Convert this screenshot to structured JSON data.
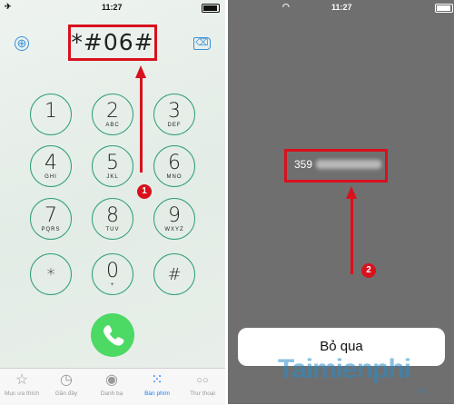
{
  "left_status": {
    "airplane": "✈",
    "time": "11:27"
  },
  "right_status": {
    "wifi": "◠",
    "time": "11:27"
  },
  "dialer": {
    "typed_number": "*#06#",
    "add_icon": "⊕",
    "delete_icon": "⌫",
    "keys": [
      {
        "digit": "1",
        "letters": ""
      },
      {
        "digit": "2",
        "letters": "ABC"
      },
      {
        "digit": "3",
        "letters": "DEF"
      },
      {
        "digit": "4",
        "letters": "GHI"
      },
      {
        "digit": "5",
        "letters": "JKL"
      },
      {
        "digit": "6",
        "letters": "MNO"
      },
      {
        "digit": "7",
        "letters": "PQRS"
      },
      {
        "digit": "8",
        "letters": "TUV"
      },
      {
        "digit": "9",
        "letters": "WXYZ"
      },
      {
        "digit": "*",
        "letters": ""
      },
      {
        "digit": "0",
        "letters": "+"
      },
      {
        "digit": "#",
        "letters": ""
      }
    ],
    "call_icon": "phone-icon",
    "step1": "1"
  },
  "tabbar": {
    "favorites": {
      "icon": "☆",
      "label": "Mục ưa thích"
    },
    "recents": {
      "icon": "◷",
      "label": "Gần đây"
    },
    "contacts": {
      "icon": "◉",
      "label": "Danh bạ"
    },
    "keypad": {
      "icon": "⁙",
      "label": "Bàn phím"
    },
    "voicemail": {
      "icon": "○○",
      "label": "Thư thoại"
    }
  },
  "result": {
    "imei_prefix": "359",
    "step2": "2",
    "skip_label": "Bỏ qua"
  },
  "watermark": {
    "brand": "Taimienphi",
    "domain": ".vn"
  },
  "colors": {
    "accent_red": "#d8111d",
    "key_ring": "#2f9e7a",
    "call_green": "#4cd964",
    "tab_active": "#1d7cf2"
  }
}
